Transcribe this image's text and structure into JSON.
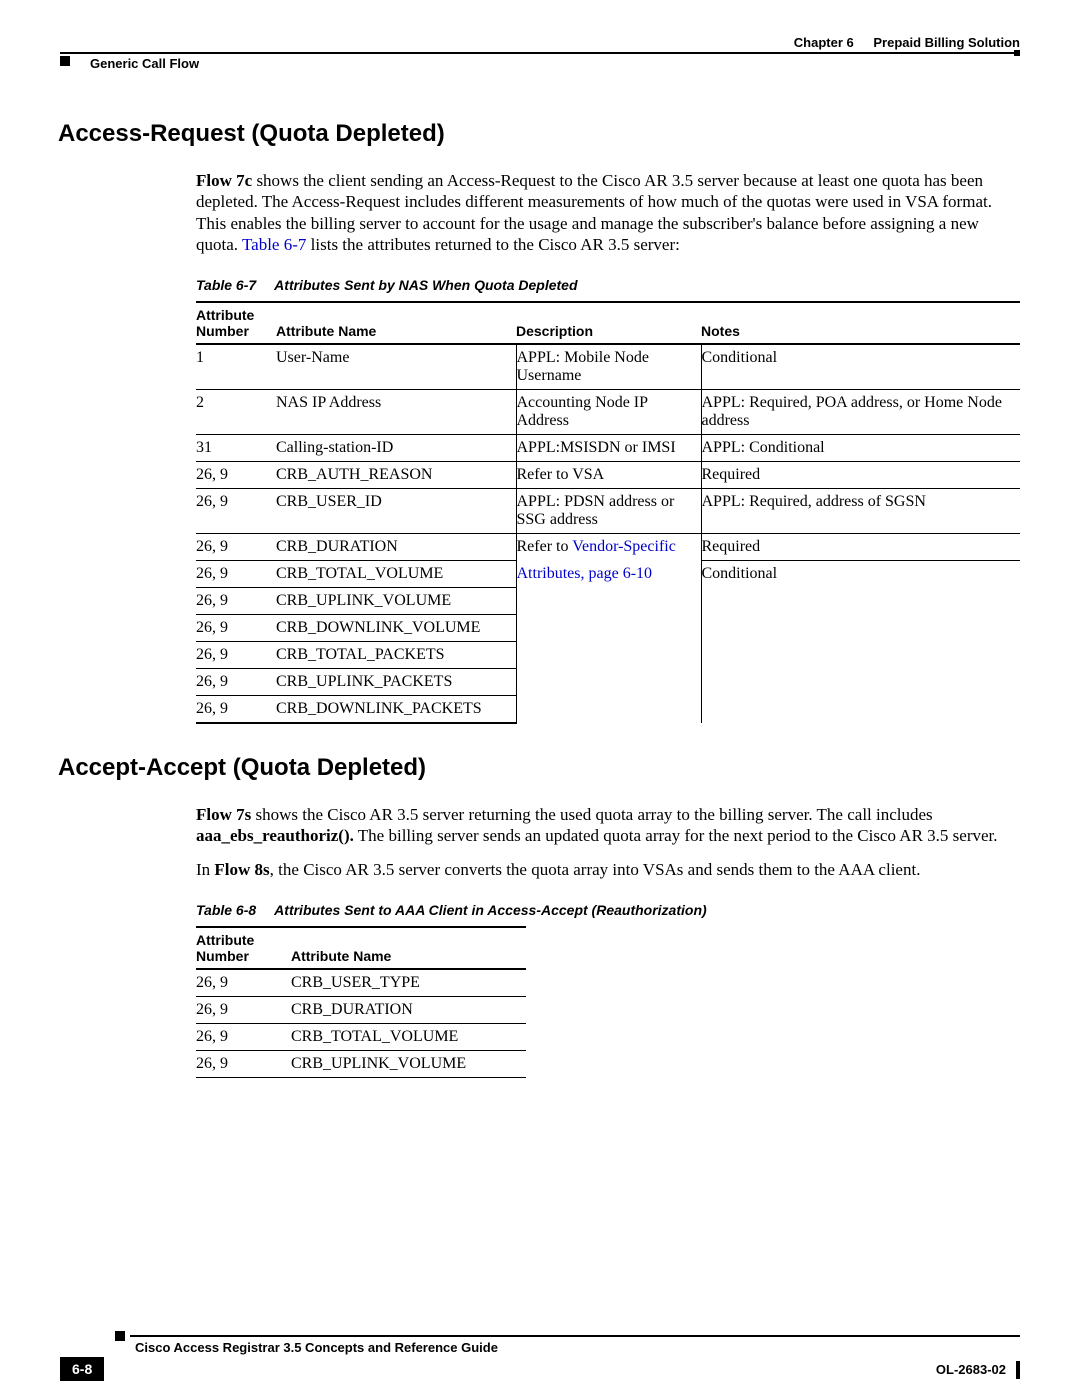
{
  "header": {
    "chapter_label": "Chapter 6",
    "chapter_title": "Prepaid Billing Solution",
    "section": "Generic Call Flow"
  },
  "section1": {
    "title": "Access-Request (Quota Depleted)",
    "flow_label": "Flow 7c",
    "para_a": " shows the client sending an Access-Request to the Cisco AR 3.5 server because at least one quota has been depleted. The Access-Request includes different measurements of how much of the quotas were used in VSA format. This enables the billing server to account for the usage and manage the subscriber's balance before assigning a new quota. ",
    "link": "Table 6-7",
    "para_b": " lists the attributes returned to the Cisco AR 3.5 server:",
    "table_caption_num": "Table 6-7",
    "table_caption_text": "Attributes Sent by NAS When Quota Depleted",
    "headers": {
      "c1": "Attribute Number",
      "c2": "Attribute Name",
      "c3": "Description",
      "c4": "Notes"
    },
    "link_vsa_a": "Vendor-Specific ",
    "link_vsa_b": "Attributes, page 6-10",
    "rows": [
      {
        "num": "1",
        "name": "User-Name",
        "desc": "APPL: Mobile Node Username",
        "notes": "Conditional"
      },
      {
        "num": "2",
        "name": "NAS IP Address",
        "desc": "Accounting Node IP Address",
        "notes": "APPL: Required, POA address, or Home Node address"
      },
      {
        "num": "31",
        "name": "Calling-station-ID",
        "desc": "APPL:MSISDN or IMSI",
        "notes": "APPL: Conditional"
      },
      {
        "num": "26, 9",
        "name": "CRB_AUTH_REASON",
        "desc": "Refer to VSA",
        "notes": "Required"
      },
      {
        "num": "26, 9",
        "name": "CRB_USER_ID",
        "desc": "APPL: PDSN address or SSG address",
        "notes": "APPL: Required, address of SGSN"
      },
      {
        "num": "26, 9",
        "name": "CRB_DURATION",
        "desc": "Refer to ",
        "notes": "Required"
      },
      {
        "num": "26, 9",
        "name": "CRB_TOTAL_VOLUME",
        "desc": "",
        "notes": "Conditional"
      },
      {
        "num": "26, 9",
        "name": "CRB_UPLINK_VOLUME",
        "desc": "",
        "notes": ""
      },
      {
        "num": "26, 9",
        "name": "CRB_DOWNLINK_VOLUME",
        "desc": "",
        "notes": ""
      },
      {
        "num": "26, 9",
        "name": "CRB_TOTAL_PACKETS",
        "desc": "",
        "notes": ""
      },
      {
        "num": "26, 9",
        "name": "CRB_UPLINK_PACKETS",
        "desc": "",
        "notes": ""
      },
      {
        "num": "26, 9",
        "name": "CRB_DOWNLINK_PACKETS",
        "desc": "",
        "notes": ""
      }
    ]
  },
  "section2": {
    "title": "Accept-Accept (Quota Depleted)",
    "flow1_label": "Flow 7s",
    "para1_a": " shows the Cisco AR 3.5 server returning the used quota array to the billing server. The call includes ",
    "bold1": "aaa_ebs_reauthoriz().",
    "para1_b": " The billing server sends an updated quota array for the next period to the Cisco AR 3.5 server.",
    "para2_a": "In ",
    "flow2_label": "Flow 8s",
    "para2_b": ", the Cisco AR 3.5 server converts the quota array into VSAs and sends them to the AAA client.",
    "table_caption_num": "Table 6-8",
    "table_caption_text": "Attributes Sent to AAA Client in Access-Accept (Reauthorization)",
    "headers": {
      "c1": "Attribute Number",
      "c2": "Attribute Name"
    },
    "rows": [
      {
        "num": "26, 9",
        "name": "CRB_USER_TYPE"
      },
      {
        "num": "26, 9",
        "name": "CRB_DURATION"
      },
      {
        "num": "26, 9",
        "name": "CRB_TOTAL_VOLUME"
      },
      {
        "num": "26, 9",
        "name": "CRB_UPLINK_VOLUME"
      }
    ]
  },
  "footer": {
    "book_title": "Cisco Access Registrar 3.5 Concepts and Reference Guide",
    "page_num": "6-8",
    "doc_id": "OL-2683-02"
  }
}
